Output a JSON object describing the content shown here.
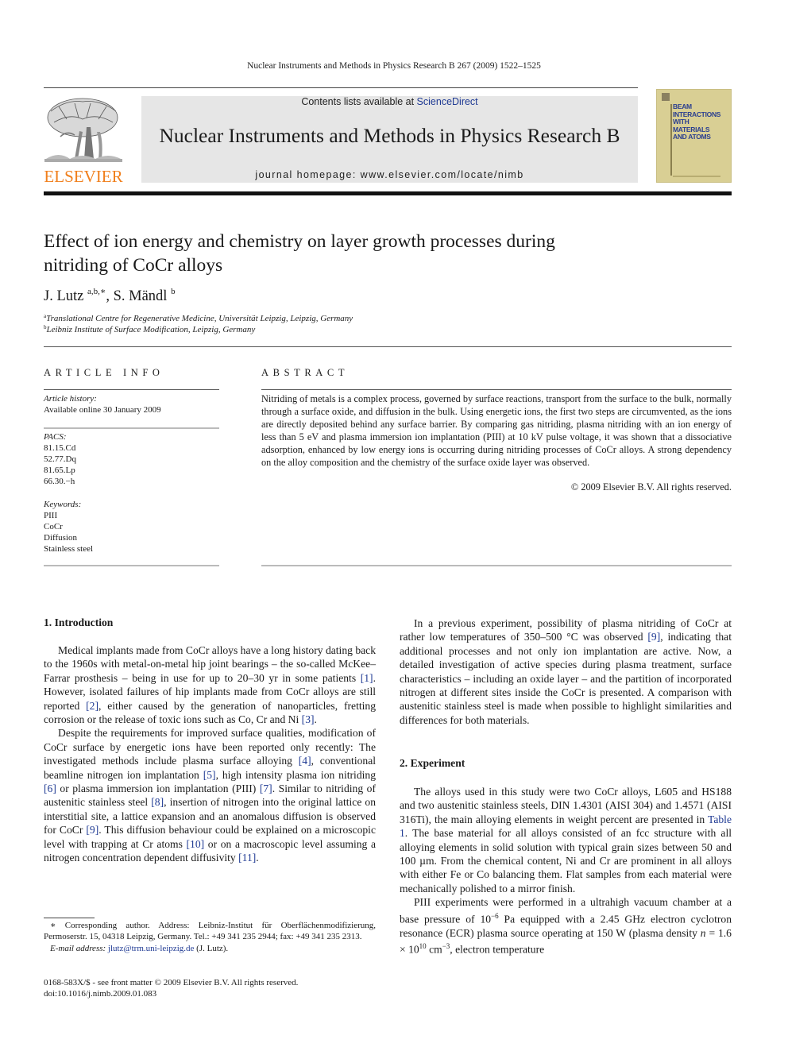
{
  "running_head": "Nuclear Instruments and Methods in Physics Research B 267 (2009) 1522–1525",
  "masthead": {
    "publisher_logo_icon": "elsevier-tree-icon",
    "publisher_name": "ELSEVIER",
    "contents_prefix": "Contents lists available at ",
    "contents_link": "ScienceDirect",
    "journal_title": "Nuclear Instruments and Methods in Physics Research B",
    "homepage_prefix": "journal homepage: ",
    "homepage_url": "www.elsevier.com/locate/nimb",
    "cover_lines": [
      "BEAM",
      "INTERACTIONS",
      "WITH",
      "MATERIALS",
      "AND ATOMS"
    ],
    "colors": {
      "elsevier_orange": "#f07f1c",
      "link_blue": "#1f3a93",
      "banner_gray": "#e6e6e6",
      "cover_tan": "#d9cf94"
    }
  },
  "article": {
    "title_line1": "Effect of ion energy and chemistry on layer growth processes during",
    "title_line2": "nitriding of CoCr alloys",
    "authors": [
      {
        "name": "J. Lutz",
        "marks": "a,b,∗"
      },
      {
        "name": "S. Mändl",
        "marks": "b"
      }
    ],
    "author_separator": ", ",
    "affiliations": [
      {
        "mark": "a",
        "text": "Translational Centre for Regenerative Medicine, Universität Leipzig, Leipzig, Germany"
      },
      {
        "mark": "b",
        "text": "Leibniz Institute of Surface Modification, Leipzig, Germany"
      }
    ]
  },
  "article_info": {
    "heading": "ARTICLE INFO",
    "history_label": "Article history:",
    "history_value": "Available online 30 January 2009",
    "pacs_label": "PACS:",
    "pacs": [
      "81.15.Cd",
      "52.77.Dq",
      "81.65.Lp",
      "66.30.−h"
    ],
    "keywords_label": "Keywords:",
    "keywords": [
      "PIII",
      "CoCr",
      "Diffusion",
      "Stainless steel"
    ]
  },
  "abstract": {
    "heading": "ABSTRACT",
    "text": "Nitriding of metals is a complex process, governed by surface reactions, transport from the surface to the bulk, normally through a surface oxide, and diffusion in the bulk. Using energetic ions, the first two steps are circumvented, as the ions are directly deposited behind any surface barrier. By comparing gas nitriding, plasma nitriding with an ion energy of less than 5 eV and plasma immersion ion implantation (PIII) at 10 kV pulse voltage, it was shown that a dissociative adsorption, enhanced by low energy ions is occurring during nitriding processes of CoCr alloys. A strong dependency on the alloy composition and the chemistry of the surface oxide layer was observed.",
    "copyright": "© 2009 Elsevier B.V. All rights reserved."
  },
  "body": {
    "intro_heading": "1. Introduction",
    "intro_p1": [
      {
        "t": "Medical implants made from CoCr alloys have a long history dating back to the 1960s with metal-on-metal hip joint bearings – the so-called McKee–Farrar prosthesis – being in use for up to 20–30 yr in some patients "
      },
      {
        "r": "[1]"
      },
      {
        "t": ". However, isolated failures of hip implants made from CoCr alloys are still reported "
      },
      {
        "r": "[2]"
      },
      {
        "t": ", either caused by the generation of nanoparticles, fretting corrosion or the release of toxic ions such as Co, Cr and Ni "
      },
      {
        "r": "[3]"
      },
      {
        "t": "."
      }
    ],
    "intro_p2": [
      {
        "t": "Despite the requirements for improved surface qualities, modification of CoCr surface by energetic ions have been reported only recently: The investigated methods include plasma surface alloying "
      },
      {
        "r": "[4]"
      },
      {
        "t": ", conventional beamline nitrogen ion implantation "
      },
      {
        "r": "[5]"
      },
      {
        "t": ", high intensity plasma ion nitriding "
      },
      {
        "r": "[6]"
      },
      {
        "t": " or plasma immersion ion implantation (PIII) "
      },
      {
        "r": "[7]"
      },
      {
        "t": ". Similar to nitriding of austenitic stainless steel "
      },
      {
        "r": "[8]"
      },
      {
        "t": ", insertion of nitrogen into the original lattice on interstitial site, a lattice expansion and an anomalous diffusion is observed for CoCr "
      },
      {
        "r": "[9]"
      },
      {
        "t": ". This diffusion behaviour could be explained on a microscopic level with trapping at Cr atoms "
      },
      {
        "r": "[10]"
      },
      {
        "t": " or on a macroscopic level assuming a nitrogen concentration dependent diffusivity "
      },
      {
        "r": "[11]"
      },
      {
        "t": "."
      }
    ],
    "intro_p3": [
      {
        "t": "In a previous experiment, possibility of plasma nitriding of CoCr at rather low temperatures of 350–500 °C was observed "
      },
      {
        "r": "[9]"
      },
      {
        "t": ", indicating that additional processes and not only ion implantation are active. Now, a detailed investigation of active species during plasma treatment, surface characteristics – including an oxide layer – and the partition of incorporated nitrogen at different sites inside the CoCr is presented. A comparison with austenitic stainless steel is made when possible to highlight similarities and differences for both materials."
      }
    ],
    "exp_heading": "2. Experiment",
    "exp_p1": [
      {
        "t": "The alloys used in this study were two CoCr alloys, L605 and HS188 and two austenitic stainless steels, DIN 1.4301 (AISI 304) and 1.4571 (AISI 316Ti), the main alloying elements in weight percent are presented in "
      },
      {
        "r": "Table 1"
      },
      {
        "t": ". The base material for all alloys consisted of an fcc structure with all alloying elements in solid solution with typical grain sizes between 50 and 100 µm. From the chemical content, Ni and Cr are prominent in all alloys with either Fe or Co balancing them. Flat samples from each material were mechanically polished to a mirror finish."
      }
    ],
    "exp_p2": [
      {
        "t": "PIII experiments were performed in a ultrahigh vacuum chamber at a base pressure of 10"
      },
      {
        "sup": "−6"
      },
      {
        "t": " Pa equipped with a 2.45 GHz electron cyclotron resonance (ECR) plasma source operating at 150 W (plasma density "
      },
      {
        "i": "n"
      },
      {
        "t": " = 1.6 × 10"
      },
      {
        "sup": "10"
      },
      {
        "t": " cm"
      },
      {
        "sup": "−3"
      },
      {
        "t": ", electron temperature"
      }
    ]
  },
  "footnotes": {
    "corresponding": "∗ Corresponding author. Address: Leibniz-Institut für Oberflächenmodifizierung, Permoserstr. 15, 04318 Leipzig, Germany. Tel.: +49 341 235 2944; fax: +49 341 235 2313.",
    "email_label": "E-mail address: ",
    "email": "jlutz@trm.uni-leipzig.de",
    "email_suffix": " (J. Lutz).",
    "issn_line": "0168-583X/$ - see front matter © 2009 Elsevier B.V. All rights reserved.",
    "doi_line": "doi:10.1016/j.nimb.2009.01.083"
  }
}
